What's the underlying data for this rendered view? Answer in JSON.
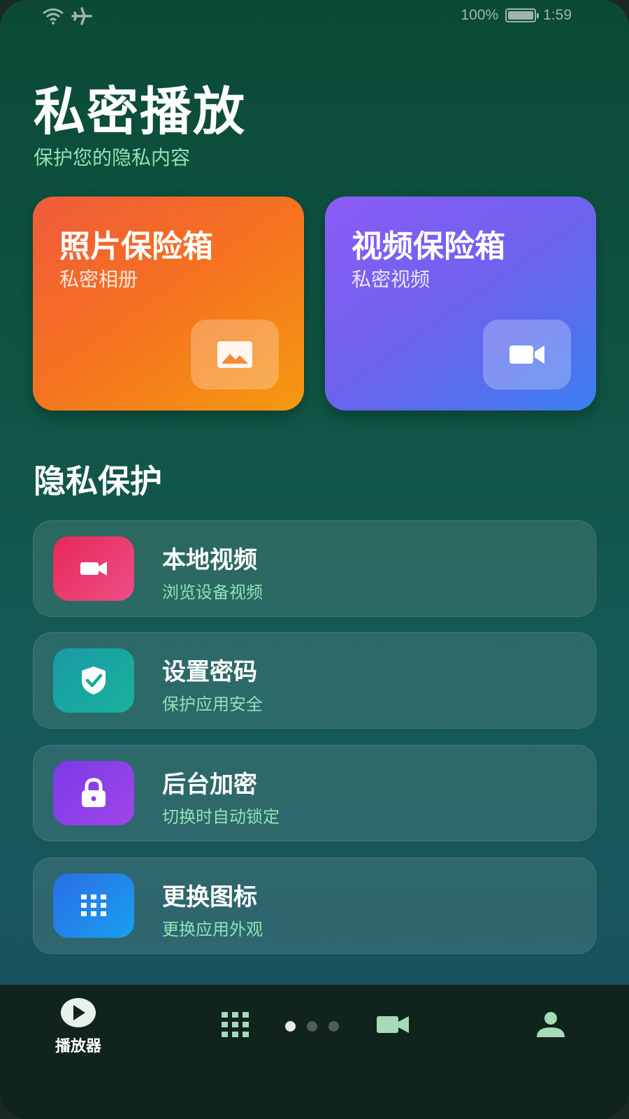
{
  "status_bar": {
    "battery": "100%",
    "time": "1:59"
  },
  "header": {
    "title": "私密播放",
    "subtitle": "保护您的隐私内容"
  },
  "vaults": [
    {
      "title": "照片保险箱",
      "subtitle": "私密相册",
      "icon": "image-icon"
    },
    {
      "title": "视频保险箱",
      "subtitle": "私密视频",
      "icon": "video-camera-icon"
    }
  ],
  "section": {
    "title": "隐私保护"
  },
  "items": [
    {
      "title": "本地视频",
      "subtitle": "浏览设备视频",
      "icon": "video-camera-icon",
      "color": "#e8366a"
    },
    {
      "title": "设置密码",
      "subtitle": "保护应用安全",
      "icon": "shield-check-icon",
      "color": "#18a99e"
    },
    {
      "title": "后台加密",
      "subtitle": "切换时自动锁定",
      "icon": "lock-icon",
      "color": "#8b3ee6"
    },
    {
      "title": "更换图标",
      "subtitle": "更换应用外观",
      "icon": "grid-icon",
      "color": "#2a84ec"
    }
  ],
  "nav": {
    "player_label": "播放器",
    "page_indicator": {
      "count": 3,
      "active": 0
    }
  },
  "colors": {
    "accent_green": "#8fe3b4",
    "nav_icon": "#a5dbb8"
  }
}
